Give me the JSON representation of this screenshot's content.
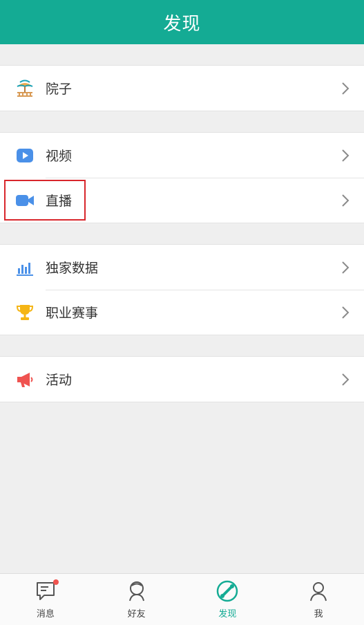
{
  "header": {
    "title": "发现"
  },
  "groups": [
    {
      "items": [
        {
          "label": "院子",
          "icon": "courtyard-icon"
        }
      ]
    },
    {
      "items": [
        {
          "label": "视频",
          "icon": "video-play-icon"
        },
        {
          "label": "直播",
          "icon": "live-camera-icon",
          "highlighted": true
        }
      ]
    },
    {
      "items": [
        {
          "label": "独家数据",
          "icon": "bar-chart-icon"
        },
        {
          "label": "职业赛事",
          "icon": "trophy-icon"
        }
      ]
    },
    {
      "items": [
        {
          "label": "活动",
          "icon": "megaphone-icon"
        }
      ]
    }
  ],
  "tabbar": {
    "tabs": [
      {
        "label": "消息",
        "icon": "message-icon",
        "badge": true
      },
      {
        "label": "好友",
        "icon": "friends-icon"
      },
      {
        "label": "发现",
        "icon": "discover-icon",
        "active": true
      },
      {
        "label": "我",
        "icon": "profile-icon"
      }
    ]
  },
  "colors": {
    "brand": "#14ab94",
    "highlight_box": "#d8262b",
    "badge": "#f0544f"
  }
}
